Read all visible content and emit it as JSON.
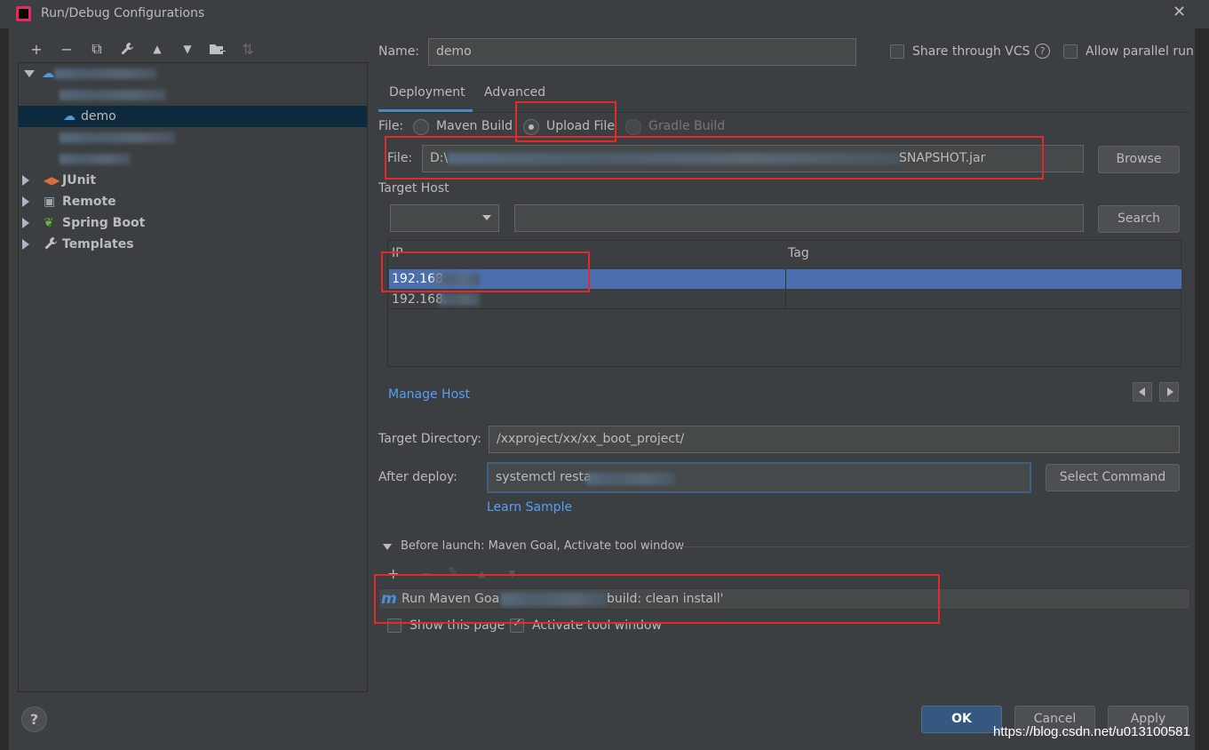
{
  "window": {
    "title": "Run/Debug Configurations"
  },
  "toolbar": {
    "buttons": [
      {
        "icon": "plus-icon",
        "glyph": "+"
      },
      {
        "icon": "minus-icon",
        "glyph": "−"
      },
      {
        "icon": "copy-icon",
        "glyph": "⧉"
      },
      {
        "icon": "wrench-icon",
        "glyph": "🔧"
      },
      {
        "icon": "move-up-icon",
        "glyph": "▲"
      },
      {
        "icon": "move-down-icon",
        "glyph": "▼"
      },
      {
        "icon": "folder-add-icon",
        "glyph": "▆"
      },
      {
        "icon": "sort-icon",
        "glyph": "⇅"
      }
    ]
  },
  "tree": {
    "selected_item": "demo",
    "groups": [
      "JUnit",
      "Remote",
      "Spring Boot",
      "Templates"
    ]
  },
  "form": {
    "name_label": "Name:",
    "name_value": "demo",
    "share_vcs_label": "Share through VCS",
    "allow_parallel_label": "Allow parallel run",
    "tabs": [
      "Deployment",
      "Advanced"
    ],
    "file_type_label": "File:",
    "file_types": [
      "Maven Build",
      "Upload File",
      "Gradle Build"
    ],
    "selected_file_type": "Upload File",
    "file_label": "File:",
    "file_prefix": "D:\\",
    "file_suffix": "SNAPSHOT.jar",
    "browse_label": "Browse",
    "target_host_label": "Target Host",
    "search_label": "Search",
    "host_table": {
      "columns": [
        "IP",
        "Tag"
      ],
      "rows": [
        {
          "ip": "192.168",
          "tag": ""
        },
        {
          "ip": "192.168.",
          "tag": ""
        }
      ]
    },
    "manage_host_label": "Manage Host",
    "target_dir_label": "Target Directory:",
    "target_dir_value": "/xxproject/xx/xx_boot_project/",
    "after_deploy_label": "After deploy:",
    "after_deploy_value": "systemctl resta",
    "select_command_label": "Select Command",
    "learn_sample_label": "Learn Sample",
    "before_launch_label": "Before launch: Maven Goal, Activate tool window",
    "launch_task_prefix": "Run Maven Goa",
    "launch_task_suffix": "build: clean install'",
    "show_page_label": "Show this page",
    "activate_tool_label": "Activate tool window"
  },
  "footer": {
    "ok_label": "OK",
    "cancel_label": "Cancel",
    "apply_label": "Apply",
    "help_label": "?"
  },
  "watermark": "https://blog.csdn.net/u013100581",
  "colors": {
    "background": "#3c3f41",
    "selection": "#4b6eaf",
    "link": "#589df6",
    "annotation": "#e22a2a"
  }
}
